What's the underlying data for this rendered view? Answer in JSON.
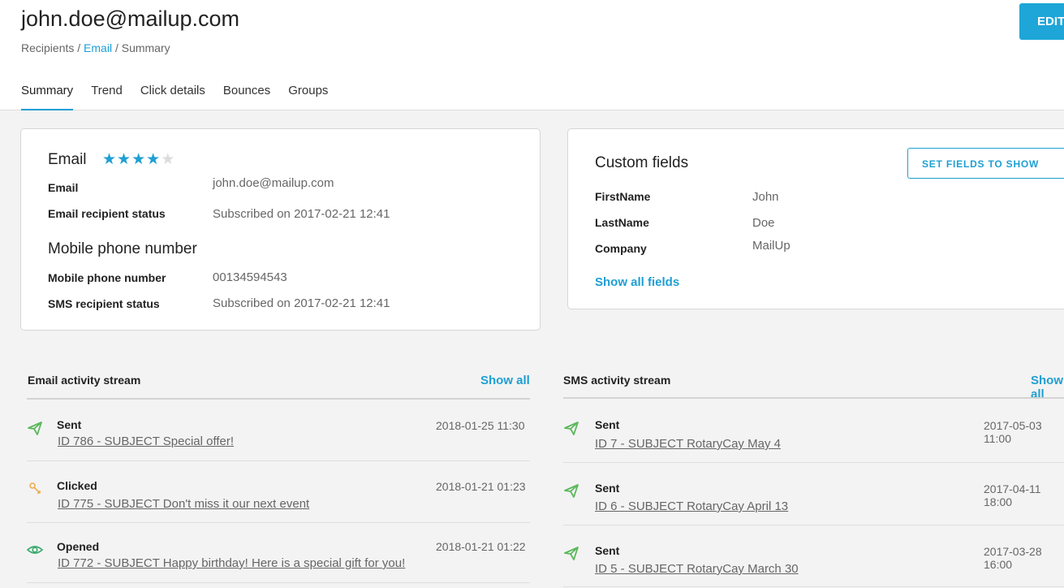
{
  "header": {
    "title": "john.doe@mailup.com",
    "breadcrumb": {
      "part1": "Recipients /",
      "part2": "Email",
      "part3": "/ Summary"
    },
    "edit_label": "EDIT"
  },
  "tabs": [
    {
      "label": "Summary",
      "active": true
    },
    {
      "label": "Trend",
      "active": false
    },
    {
      "label": "Click details",
      "active": false
    },
    {
      "label": "Bounces",
      "active": false
    },
    {
      "label": "Groups",
      "active": false
    }
  ],
  "contact_card": {
    "email_section_title": "Email",
    "rating": {
      "value": 4,
      "max": 5
    },
    "email_label": "Email",
    "email_value": "john.doe@mailup.com",
    "email_status_label": "Email recipient status",
    "email_status_value": "Subscribed on 2017-02-21 12:41",
    "mobile_section_title": "Mobile phone number",
    "mobile_label": "Mobile phone number",
    "mobile_value": "00134594543",
    "sms_status_label": "SMS recipient status",
    "sms_status_value": "Subscribed on 2017-02-21 12:41"
  },
  "custom_fields": {
    "title": "Custom fields",
    "set_button": "SET FIELDS TO SHOW",
    "fields": [
      {
        "name": "FirstName",
        "value": "John"
      },
      {
        "name": "LastName",
        "value": "Doe"
      },
      {
        "name": "Company",
        "value": "MailUp"
      }
    ],
    "show_all": "Show all fields"
  },
  "email_stream": {
    "title": "Email activity stream",
    "show_all": "Show all",
    "items": [
      {
        "status": "Sent",
        "date": "2018-01-25 11:30",
        "subject": "ID 786 - SUBJECT Special offer!",
        "icon": "paper-plane-icon"
      },
      {
        "status": "Clicked",
        "date": "2018-01-21 01:23",
        "subject": "ID 775 - SUBJECT Don't miss it our next event",
        "icon": "click-icon"
      },
      {
        "status": "Opened",
        "date": "2018-01-21 01:22",
        "subject": "ID 772 - SUBJECT Happy birthday! Here is a special gift for you!",
        "icon": "eye-icon"
      }
    ]
  },
  "sms_stream": {
    "title": "SMS activity stream",
    "show_all": "Show all",
    "items": [
      {
        "status": "Sent",
        "date": "2017-05-03 11:00",
        "subject": "ID 7 - SUBJECT RotaryCay May 4",
        "icon": "paper-plane-icon"
      },
      {
        "status": "Sent",
        "date": "2017-04-11 18:00",
        "subject": "ID 6 - SUBJECT RotaryCay April 13",
        "icon": "paper-plane-icon"
      },
      {
        "status": "Sent",
        "date": "2017-03-28 16:00",
        "subject": "ID 5 - SUBJECT RotaryCay March 30",
        "icon": "paper-plane-icon"
      }
    ]
  },
  "colors": {
    "accent": "#1e9fd3",
    "sent": "#5cb85c",
    "clicked": "#f0ad4e",
    "opened": "#3aaa6e"
  }
}
